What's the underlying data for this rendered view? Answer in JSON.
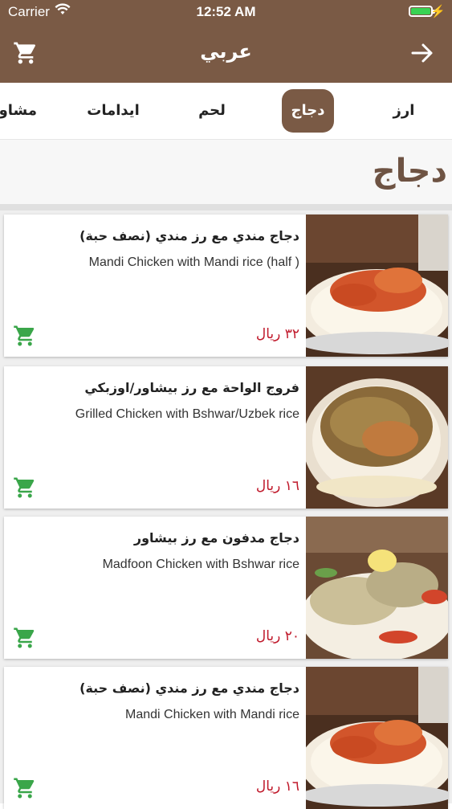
{
  "status_bar": {
    "carrier": "Carrier",
    "time": "12:52 AM",
    "battery_level": 1.0
  },
  "navbar": {
    "title": "عربي",
    "cart_icon": "cart-icon",
    "back_icon": "arrow-right-icon"
  },
  "tabs": [
    {
      "label": "ارز",
      "active": false
    },
    {
      "label": "دجاج",
      "active": true
    },
    {
      "label": "لحم",
      "active": false
    },
    {
      "label": "ايدامات",
      "active": false
    },
    {
      "label": "مشاوي",
      "active": false
    }
  ],
  "section_title": "دجاج",
  "items": [
    {
      "name_ar": "دجاج مندي مع رز مندي (نصف حبة)",
      "name_en": "Mandi Chicken  with Mandi rice (half )",
      "price": "٣٢ ريال"
    },
    {
      "name_ar": "فروج الواحة مع رز بيشاور/اوزبكي",
      "name_en": "Grilled Chicken  with  Bshwar/Uzbek rice",
      "price": "١٦ ريال"
    },
    {
      "name_ar": "دجاج مدفون مع رز بيشاور",
      "name_en": "Madfoon Chicken  with  Bshwar rice",
      "price": "٢٠ ريال"
    },
    {
      "name_ar": "دجاج مندي مع رز مندي (نصف حبة)",
      "name_en": "Mandi Chicken  with Mandi rice",
      "price": "١٦ ريال"
    }
  ],
  "colors": {
    "brand_brown": "#7a5a45",
    "price_red": "#c0192b",
    "cart_green": "#3aa64a"
  }
}
